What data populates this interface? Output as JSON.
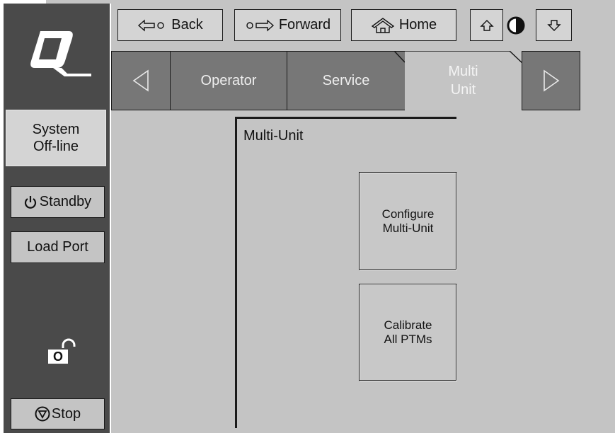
{
  "nav": {
    "back_label": "Back",
    "forward_label": "Forward",
    "home_label": "Home"
  },
  "tabs": [
    {
      "label": "Operator"
    },
    {
      "label": "Service"
    },
    {
      "label_line1": "Multi",
      "label_line2": "Unit",
      "active": true
    }
  ],
  "sidebar": {
    "status_line1": "System",
    "status_line2": "Off-line",
    "standby_label": "Standby",
    "load_port_label": "Load Port",
    "stop_label": "Stop",
    "lock_letter": "O"
  },
  "main": {
    "group_title": "Multi-Unit",
    "configure_line1": "Configure",
    "configure_line2": "Multi-Unit",
    "calibrate_line1": "Calibrate",
    "calibrate_line2": "All PTMs"
  },
  "colors": {
    "frame_gray": "#c4c4c4",
    "dark_panel": "#4a4a4a",
    "tab_inactive": "#777777"
  }
}
